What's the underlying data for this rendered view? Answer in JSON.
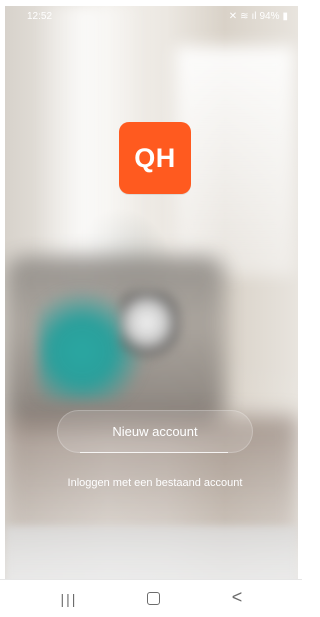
{
  "status_bar": {
    "time": "12:52",
    "battery": "94%",
    "icons": [
      "mute-icon",
      "wifi-icon",
      "signal-icon",
      "battery-icon"
    ]
  },
  "app": {
    "logo_text": "QH",
    "brand_color": "#ff5a1f"
  },
  "actions": {
    "new_account_label": "Nieuw account",
    "login_existing_label": "Inloggen met een bestaand account"
  },
  "nav_bar": {
    "recent_label": "|||",
    "home_label": "",
    "back_label": "<"
  }
}
